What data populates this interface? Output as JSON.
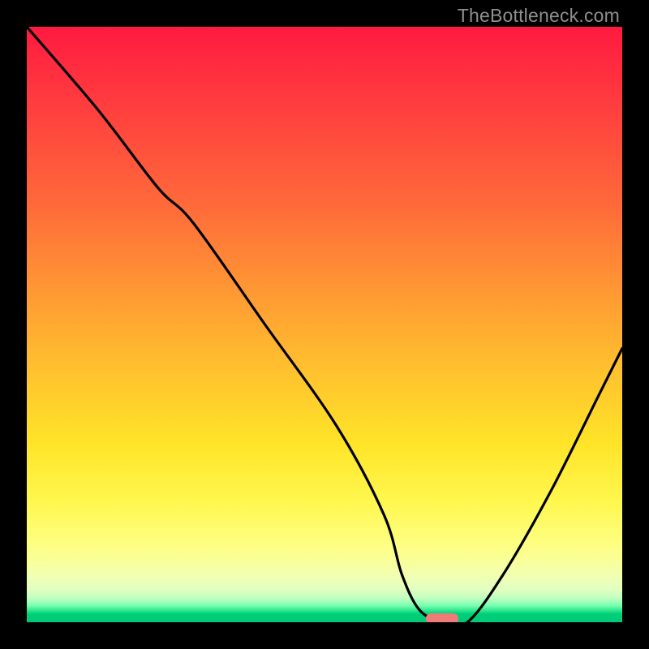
{
  "watermark": "TheBottleneck.com",
  "colors": {
    "background": "#000000",
    "curve": "#000000",
    "marker_fill": "#ef7b78",
    "marker_stroke": "#ef7b78"
  },
  "chart_data": {
    "type": "line",
    "title": "",
    "xlabel": "",
    "ylabel": "",
    "xlim": [
      0,
      100
    ],
    "ylim": [
      0,
      100
    ],
    "grid": false,
    "legend": false,
    "annotations": [],
    "series": [
      {
        "name": "bottleneck-curve",
        "x": [
          0,
          12,
          22,
          28,
          40,
          52,
          60,
          63,
          66,
          70,
          74,
          80,
          88,
          96,
          100
        ],
        "values": [
          100,
          86,
          73,
          67,
          50,
          33,
          18,
          8,
          2,
          0,
          0,
          8,
          22,
          38,
          46
        ]
      }
    ],
    "marker": {
      "x_start": 67,
      "x_end": 72.5,
      "y": 0.6,
      "shape": "rounded-rect"
    }
  }
}
